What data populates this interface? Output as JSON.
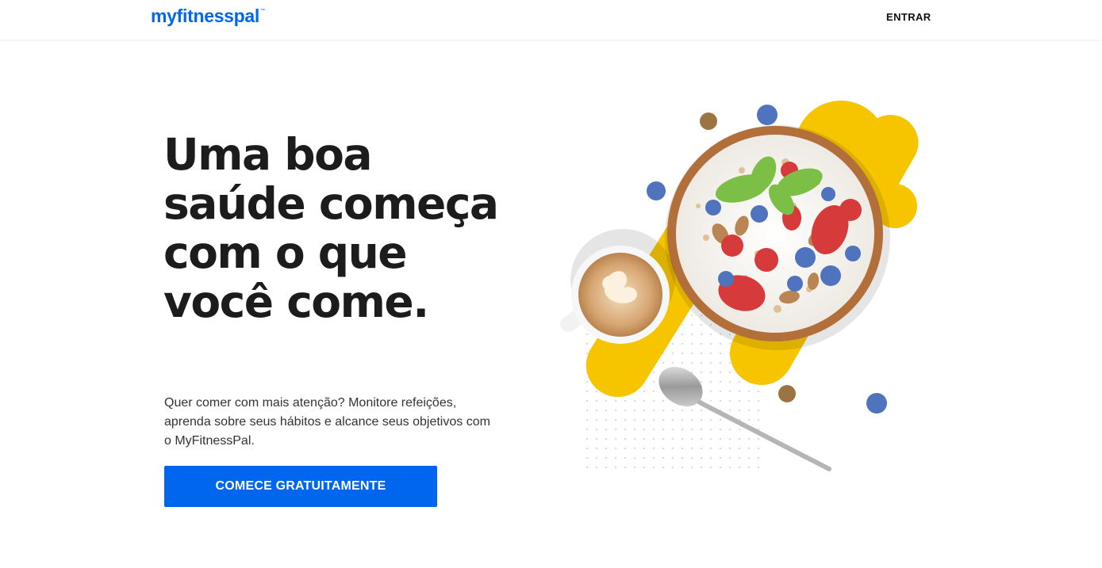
{
  "header": {
    "logo_text": "myfitnesspal",
    "logo_mark": "™",
    "login_label": "ENTRAR"
  },
  "hero": {
    "title": "Uma boa saúde começa com o que você come.",
    "subtitle": "Quer comer com mais atenção? Monitore refeições, aprenda sobre seus hábitos e alcance seus objetivos com o MyFitnessPal.",
    "cta_label": "COMECE GRATUITAMENTE"
  },
  "colors": {
    "brand_blue": "#0066ee",
    "accent_yellow": "#f7c400",
    "text_dark": "#1c1c1c"
  }
}
